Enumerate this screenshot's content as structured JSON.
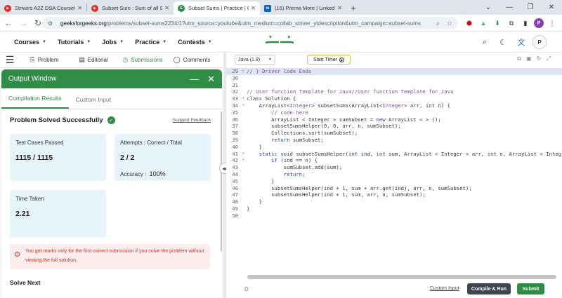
{
  "browser": {
    "tabs": [
      {
        "title": "Strivers A2Z DSA Course/Sheet",
        "favicon": "youtube",
        "active": false
      },
      {
        "title": "Subset Sum : Sum of all Subset",
        "favicon": "youtube",
        "active": false
      },
      {
        "title": "Subset Sums | Practice | Geeksf",
        "favicon": "gfg",
        "active": true
      },
      {
        "title": "(16) Prerna More | LinkedIn",
        "favicon": "linkedin",
        "active": false
      }
    ],
    "url_host": "geeksforgeeks.org",
    "url_rest": "/problems/subset-sums2234/1?utm_source=youtube&utm_medium=collab_striver_ytdescription&utm_campaign=subset-sums",
    "profile_letter": "P"
  },
  "site": {
    "menu": [
      "Courses",
      "Tutorials",
      "Jobs",
      "Practice",
      "Contests"
    ],
    "avatar_letter": "P"
  },
  "panel_tabs": [
    {
      "label": "Problem",
      "icon": "book-icon"
    },
    {
      "label": "Editorial",
      "icon": "document-icon"
    },
    {
      "label": "Submissions",
      "icon": "history-icon"
    },
    {
      "label": "Comments",
      "icon": "chat-icon"
    }
  ],
  "output": {
    "title": "Output Window",
    "tabs": [
      "Compilation Results",
      "Custom Input"
    ],
    "status": "Problem Solved Successfully",
    "suggest": "Suggest Feedback",
    "test_cases_label": "Test Cases Passed",
    "test_cases_value": "1115 / 1115",
    "attempts_label": "Attempts : Correct / Total",
    "attempts_value": "2 / 2",
    "accuracy_label": "Accuracy :",
    "accuracy_value": "100%",
    "time_label": "Time Taken",
    "time_value": "2.21",
    "notice": "You get marks only for the first correct submission if you solve the problem without viewing the full solution.",
    "solve_next": "Solve Next"
  },
  "editor": {
    "language": "Java (1.8)",
    "timer_label": "Start Timer",
    "custom_input": "Custom Input",
    "compile_run": "Compile & Run",
    "submit": "Submit",
    "lines": [
      {
        "n": "29",
        "fold": "▸",
        "text": "// } Driver Code Ends",
        "hl": true
      },
      {
        "n": "30",
        "fold": "",
        "text": ""
      },
      {
        "n": "31",
        "fold": "",
        "text": ""
      },
      {
        "n": "32",
        "fold": "",
        "text": "// User function Template for Java//User function Template for Java"
      },
      {
        "n": "33",
        "fold": "▾",
        "text": "class Solution {"
      },
      {
        "n": "34",
        "fold": "▾",
        "text": "    ArrayList<Integer> subsetSums(ArrayList<Integer> arr, int n) {"
      },
      {
        "n": "35",
        "fold": "",
        "text": "        // code here"
      },
      {
        "n": "36",
        "fold": "",
        "text": "        ArrayList < Integer > sumSubset = new ArrayList < > ();"
      },
      {
        "n": "37",
        "fold": "",
        "text": "        subsetSumsHelper(0, 0, arr, n, sumSubset);"
      },
      {
        "n": "38",
        "fold": "",
        "text": "        Collections.sort(sumSubset);"
      },
      {
        "n": "39",
        "fold": "",
        "text": "        return sumSubset;"
      },
      {
        "n": "40",
        "fold": "",
        "text": "    }"
      },
      {
        "n": "41",
        "fold": "▾",
        "text": "    static void subsetSumsHelper(int ind, int sum, ArrayList < Integer > arr, int n, ArrayList < Integ"
      },
      {
        "n": "42",
        "fold": "▾",
        "text": "        if (ind == n) {"
      },
      {
        "n": "43",
        "fold": "",
        "text": "            sumSubset.add(sum);"
      },
      {
        "n": "44",
        "fold": "",
        "text": "            return;"
      },
      {
        "n": "45",
        "fold": "",
        "text": "        }"
      },
      {
        "n": "46",
        "fold": "",
        "text": "        subsetSumsHelper(ind + 1, sum + arr.get(ind), arr, n, sumSubset);"
      },
      {
        "n": "47",
        "fold": "",
        "text": "        subsetSumsHelper(ind + 1, sum, arr, n, sumSubset);"
      },
      {
        "n": "48",
        "fold": "",
        "text": "    }"
      },
      {
        "n": "49",
        "fold": "",
        "text": "}"
      },
      {
        "n": "50",
        "fold": "",
        "text": ""
      }
    ]
  },
  "colors": {
    "brand": "#2f8d46",
    "card": "#e8f4fb",
    "notice_bg": "#fdecec",
    "notice_text": "#c0392b"
  }
}
